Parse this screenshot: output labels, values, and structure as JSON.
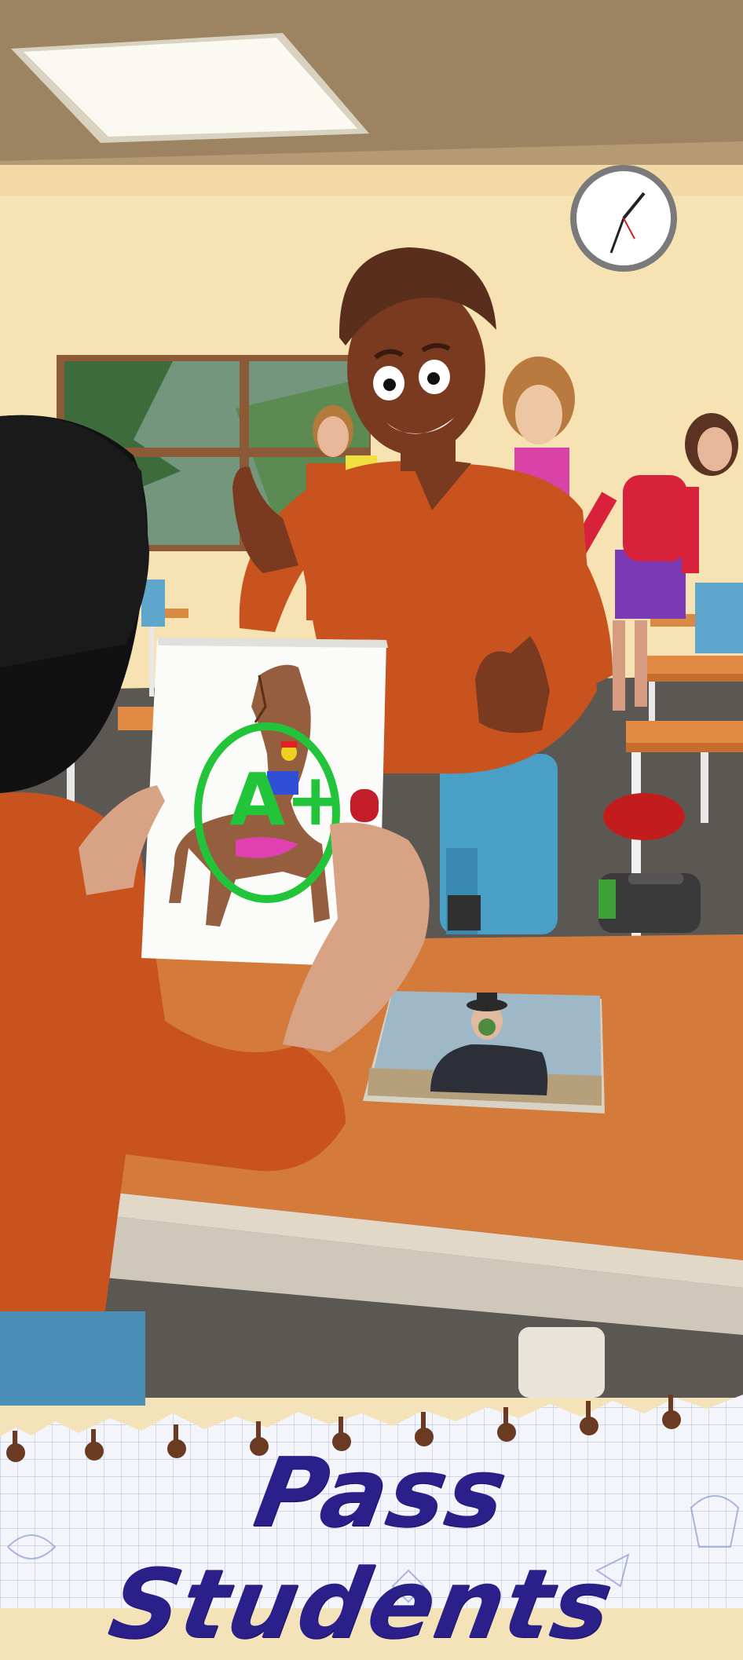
{
  "banner": {
    "title": "Pass Students"
  },
  "scene": {
    "grade_label": "A+"
  },
  "colors": {
    "wall": "#f6e2b3",
    "ceiling": "#9c8462",
    "desk": "#d47a3a",
    "shirt": "#c8531f",
    "pants": "#4a9fc7",
    "grade_circle": "#22c43a",
    "banner_ink": "#2b1f8a"
  }
}
